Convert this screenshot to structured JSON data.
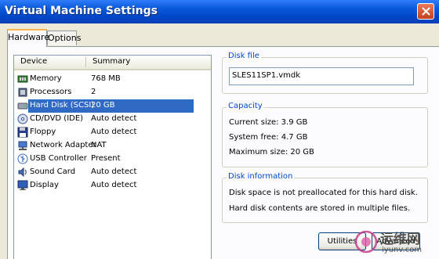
{
  "window": {
    "title": "Virtual Machine Settings"
  },
  "tabs": [
    {
      "label": "Hardware",
      "active": true
    },
    {
      "label": "Options",
      "active": false
    }
  ],
  "device_list": {
    "columns": [
      "Device",
      "Summary"
    ],
    "rows": [
      {
        "icon": "memory-icon",
        "device": "Memory",
        "summary": "768 MB"
      },
      {
        "icon": "processor-icon",
        "device": "Processors",
        "summary": "2"
      },
      {
        "icon": "hard-disk-icon",
        "device": "Hard Disk (SCSI)",
        "summary": "20 GB",
        "selected": true
      },
      {
        "icon": "cd-dvd-icon",
        "device": "CD/DVD (IDE)",
        "summary": "Auto detect"
      },
      {
        "icon": "floppy-icon",
        "device": "Floppy",
        "summary": "Auto detect"
      },
      {
        "icon": "network-adapter-icon",
        "device": "Network Adapter",
        "summary": "NAT"
      },
      {
        "icon": "usb-icon",
        "device": "USB Controller",
        "summary": "Present"
      },
      {
        "icon": "sound-card-icon",
        "device": "Sound Card",
        "summary": "Auto detect"
      },
      {
        "icon": "display-icon",
        "device": "Display",
        "summary": "Auto detect"
      }
    ]
  },
  "disk_file": {
    "legend": "Disk file",
    "value": "SLES11SP1.vmdk"
  },
  "capacity": {
    "legend": "Capacity",
    "current_size": "Current size: 3.9 GB",
    "system_free": "System free: 4.7 GB",
    "maximum_size": "Maximum size: 20 GB"
  },
  "disk_information": {
    "legend": "Disk information",
    "line1": "Disk space is not preallocated for this hard disk.",
    "line2": "Hard disk contents are stored in multiple files."
  },
  "buttons": {
    "utilities": "Utilities",
    "advanced": "Advanced"
  },
  "watermark": {
    "text": "运维网",
    "subtext": "iyunv.com"
  },
  "colors": {
    "titlebar": "#0a5bdb",
    "selection": "#316ac5",
    "group_legend": "#0046d5",
    "active_tab_highlight": "#f5b74a"
  }
}
